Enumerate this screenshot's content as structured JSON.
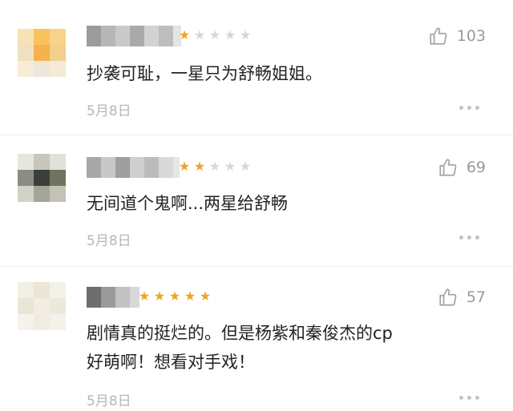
{
  "comments": [
    {
      "rating": 1,
      "like_count": "103",
      "text_lines": [
        "抄袭可耻，一星只为舒畅姐姐。"
      ],
      "date": "5月8日"
    },
    {
      "rating": 2,
      "like_count": "69",
      "text_lines": [
        "无间道个鬼啊...两星给舒畅"
      ],
      "date": "5月8日"
    },
    {
      "rating": 5,
      "like_count": "57",
      "text_lines": [
        "剧情真的挺烂的。但是杨紫和秦俊杰的cp",
        "好萌啊！想看对手戏！"
      ],
      "date": "5月8日"
    }
  ],
  "colors": {
    "star_on": "#f0a322",
    "star_off": "#d6d6d6",
    "meta_text": "#b6b6b6"
  },
  "icons": {
    "like": "thumbs-up-icon",
    "more": "more-dots-icon",
    "star": "star-icon"
  }
}
